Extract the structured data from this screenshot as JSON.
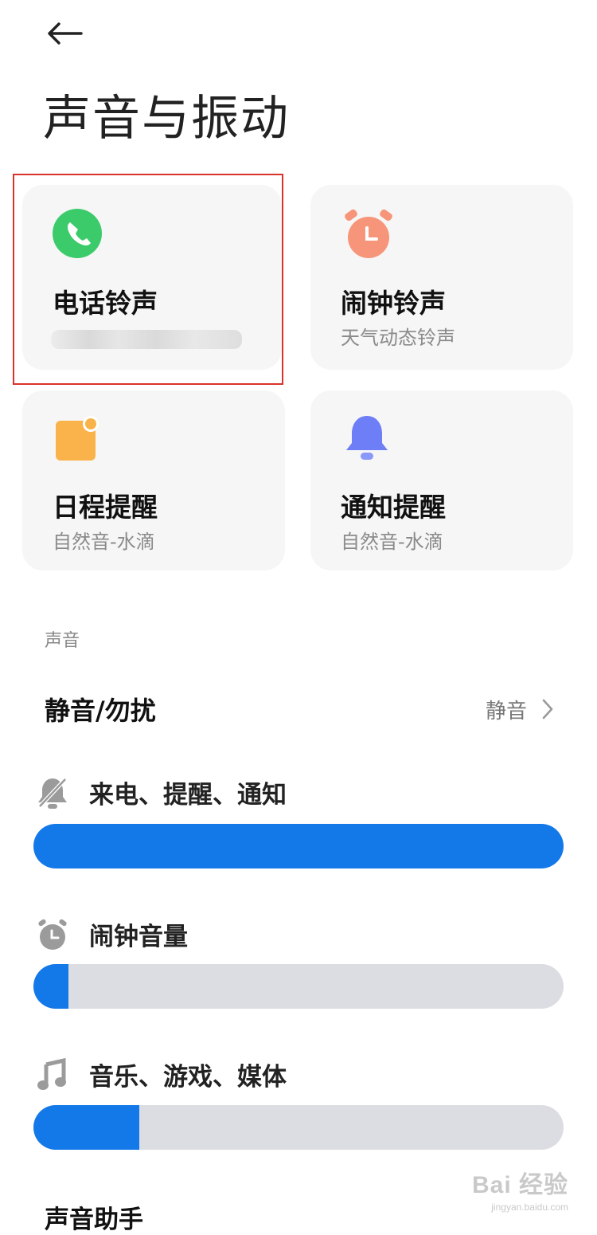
{
  "page": {
    "title": "声音与振动"
  },
  "cards": [
    {
      "label": "电话铃声",
      "sub": "",
      "icon": "phone-icon",
      "color": "#3ccb6a"
    },
    {
      "label": "闹钟铃声",
      "sub": "天气动态铃声",
      "icon": "alarm-clock-icon",
      "color": "#f6957a"
    },
    {
      "label": "日程提醒",
      "sub": "自然音-水滴",
      "icon": "calendar-icon",
      "color": "#f9b34a"
    },
    {
      "label": "通知提醒",
      "sub": "自然音-水滴",
      "icon": "bell-icon",
      "color": "#6d7ef7"
    }
  ],
  "sound_section": {
    "header": "声音",
    "mute_row": {
      "label": "静音/勿扰",
      "value": "静音"
    }
  },
  "volumes": [
    {
      "label": "来电、提醒、通知",
      "icon": "bell-muted-icon",
      "level": 1.0
    },
    {
      "label": "闹钟音量",
      "icon": "alarm-clock-icon",
      "level": 0.066
    },
    {
      "label": "音乐、游戏、媒体",
      "icon": "music-note-icon",
      "level": 0.2
    }
  ],
  "next_section": {
    "title": "声音助手"
  },
  "watermark": {
    "main": "Bai 经验",
    "sub": "jingyan.baidu.com"
  },
  "colors": {
    "accent": "#1479e8",
    "track": "#dcdde2",
    "highlight": "#d9322b"
  }
}
